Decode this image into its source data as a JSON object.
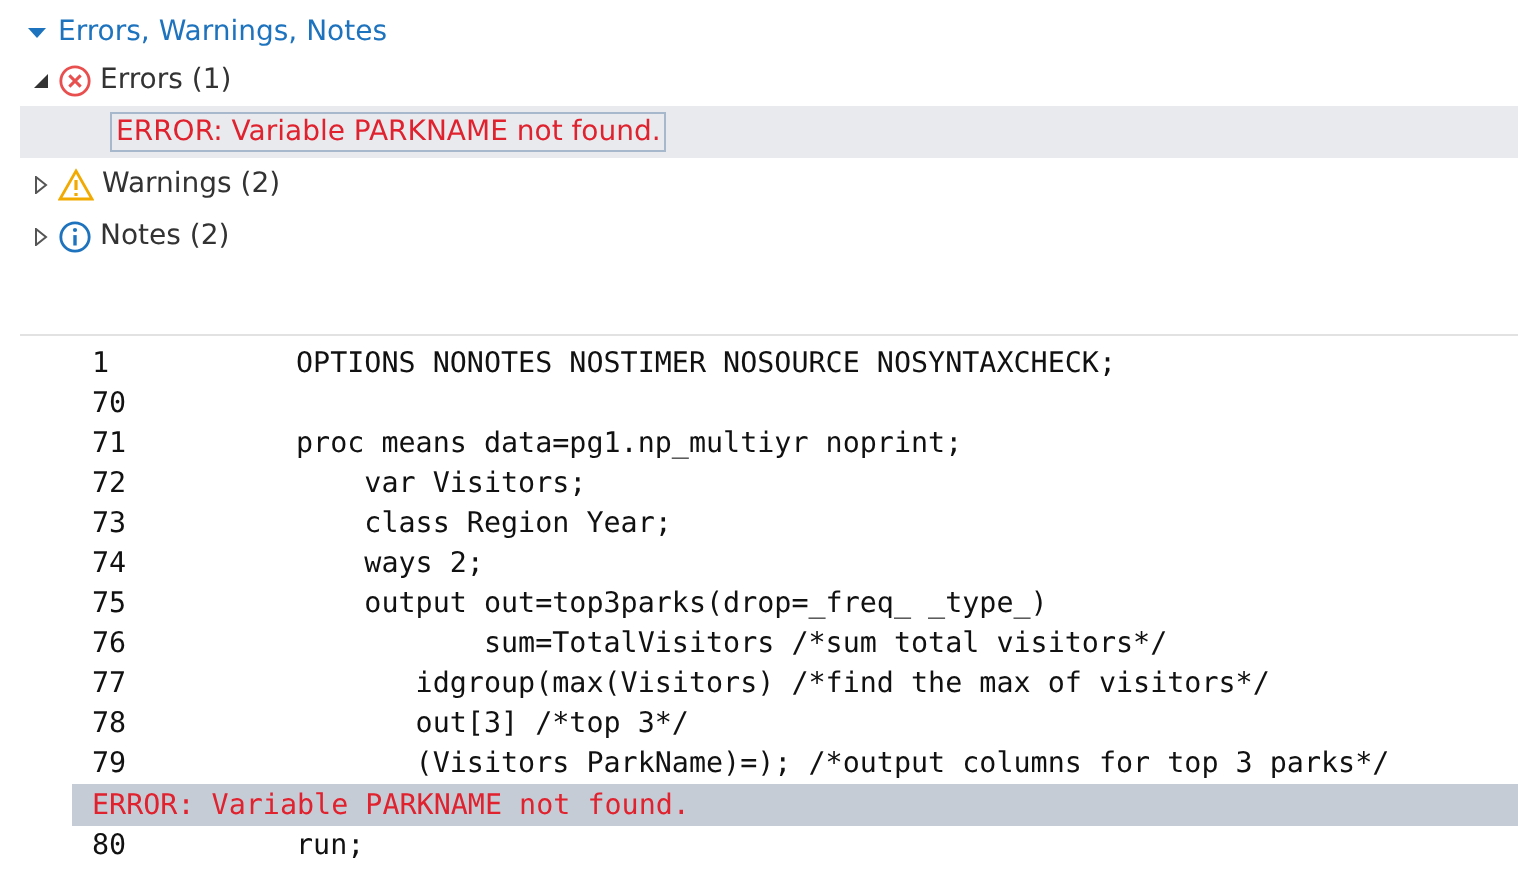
{
  "summary": {
    "title": "Errors, Warnings, Notes",
    "expanded": true,
    "groups": [
      {
        "kind": "error",
        "label": "Errors (1)",
        "expanded": true,
        "messages": [
          {
            "text": "ERROR: Variable PARKNAME not found.",
            "selected": true
          }
        ]
      },
      {
        "kind": "warning",
        "label": "Warnings (2)",
        "expanded": false
      },
      {
        "kind": "note",
        "label": "Notes (2)",
        "expanded": false
      }
    ]
  },
  "log": [
    {
      "kind": "code",
      "number": "1",
      "text": "OPTIONS NONOTES NOSTIMER NOSOURCE NOSYNTAXCHECK;"
    },
    {
      "kind": "code",
      "number": "70"
    },
    {
      "kind": "code",
      "number": "71",
      "text": "proc means data=pg1.np_multiyr noprint;"
    },
    {
      "kind": "code",
      "number": "72",
      "text": "    var Visitors;"
    },
    {
      "kind": "code",
      "number": "73",
      "text": "    class Region Year;"
    },
    {
      "kind": "code",
      "number": "74",
      "text": "    ways 2;"
    },
    {
      "kind": "code",
      "number": "75",
      "text": "    output out=top3parks(drop=_freq_ _type_)"
    },
    {
      "kind": "code",
      "number": "76",
      "text": "           sum=TotalVisitors /*sum total visitors*/"
    },
    {
      "kind": "code",
      "number": "77",
      "text": "       idgroup(max(Visitors) /*find the max of visitors*/"
    },
    {
      "kind": "code",
      "number": "78",
      "text": "       out[3] /*top 3*/"
    },
    {
      "kind": "code",
      "number": "79",
      "text": "       (Visitors ParkName)=); /*output columns for top 3 parks*/"
    },
    {
      "kind": "error",
      "text": "ERROR: Variable PARKNAME not found."
    },
    {
      "kind": "code",
      "number": "80",
      "text": "run;"
    }
  ]
}
